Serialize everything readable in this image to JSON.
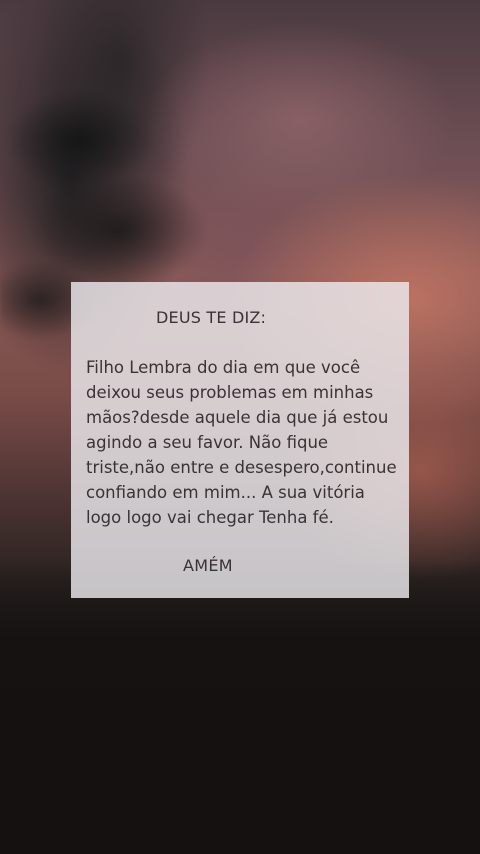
{
  "card": {
    "title": "DEUS TE DIZ:",
    "body": "Filho Lembra do dia em que você\ndeixou seus problemas em minhas\nmãos?desde aquele dia que já estou\nagindo a seu favor. Não fique\ntriste,não entre e desespero,continue\nconfiando em mim...  A sua vitória\nlogo logo vai chegar Tenha fé.",
    "footer": "AMÉM"
  },
  "colors": {
    "card_background": "#ECEAEE",
    "text": "#3A3236",
    "sky_accent": "#C47664"
  }
}
